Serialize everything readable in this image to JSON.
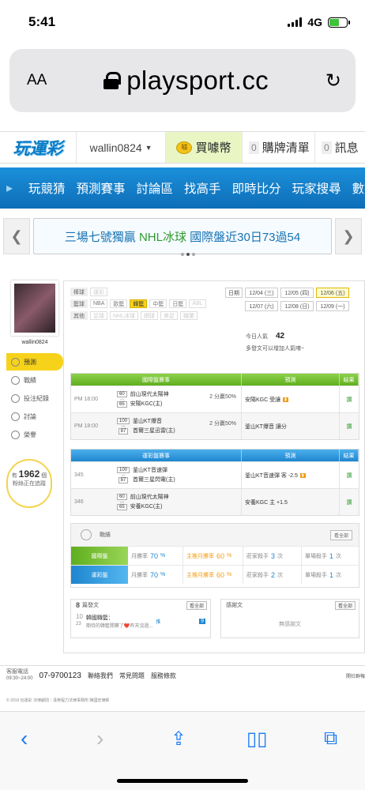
{
  "status": {
    "time": "5:41",
    "network": "4G"
  },
  "browser": {
    "aa": "AA",
    "url": "playsport.cc",
    "reload_icon": "reload-icon"
  },
  "site": {
    "logo": "玩運彩",
    "username": "wallin0824",
    "buy_label": "買噱幣",
    "cart_count": "0",
    "cart_label": "購牌清單",
    "msg_count": "0",
    "msg_label": "訊息"
  },
  "nav": [
    "玩競猜",
    "預測賽事",
    "討論區",
    "找高手",
    "即時比分",
    "玩家搜尋",
    "數據"
  ],
  "banner": {
    "text_blue": "三場七號獨贏",
    "text_green": "NHL冰球",
    "text_tail": "國際盤近30日73過54"
  },
  "sidebar": {
    "username": "wallin0824",
    "menu": [
      "預測",
      "戰績",
      "投注紀錄",
      "討論",
      "榮譽"
    ],
    "viewers_prefix": "有",
    "viewers_count": "1962",
    "viewers_suffix": "個",
    "viewers_text": "粉絲正在追蹤"
  },
  "filters": {
    "rows": [
      {
        "label": "棒球",
        "chips": [
          "運彩"
        ]
      },
      {
        "label": "籃球",
        "chips": [
          "NBA",
          "歐籃",
          "韓籃",
          "中籃",
          "日籃",
          "ABL"
        ]
      },
      {
        "label": "其他",
        "chips": [
          "足球",
          "NHL冰球",
          "網球",
          "美足",
          "職業"
        ]
      }
    ]
  },
  "dates": {
    "label": "日期",
    "row1": [
      "12/04 (三)",
      "12/05 (四)",
      "12/06 (五)"
    ],
    "row2": [
      "12/07 (六)",
      "12/08 (日)",
      "12/09 (一)"
    ]
  },
  "popularity": {
    "label": "今日人氣",
    "value": "42",
    "hint": "多發文可以增加人氣唷~"
  },
  "intl_table": {
    "headers": [
      "國際盤賽事",
      "預測",
      "結果"
    ],
    "rows": [
      {
        "time": "PM 18:00",
        "s1": "60",
        "s2": "65",
        "team1": "前山現代太陽神",
        "team2": "安陽KGC(主)",
        "pct": "2 分贏50%",
        "pred": "安陽KGC 受讓",
        "result": "讚"
      },
      {
        "time": "PM 18:00",
        "s1": "100",
        "s2": "87",
        "team1": "釜山KT爆音",
        "team2": "首爾三星迅雷(主)",
        "pct": "2 分贏50%",
        "pred": "釜山KT爆音 讓分",
        "result": "讚"
      }
    ]
  },
  "lottery_table": {
    "headers": [
      "運彩盤賽事",
      "預測",
      "結果"
    ],
    "rows": [
      {
        "time": "345",
        "s1": "100",
        "s2": "87",
        "team1": "釜山KT音速彈",
        "team2": "首爾三星閃電(主)",
        "pct": "",
        "pred": "釜山KT音速彈 客 -2.5",
        "result": "讚"
      },
      {
        "time": "346",
        "s1": "60",
        "s2": "65",
        "team1": "前山現代太陽神",
        "team2": "安養KGC(主)",
        "pct": "",
        "pred": "安養KGC 主 +1.5",
        "result": "讚"
      }
    ]
  },
  "record": {
    "title": "戰績",
    "see_all": "看全部",
    "rows": [
      {
        "label": "國際盤",
        "month": "月勝率",
        "month_v": "70",
        "main": "主推月勝率",
        "main_v": "60",
        "killer": "莊家殺手",
        "killer_v": "3",
        "single": "單場殺手",
        "single_v": "1"
      },
      {
        "label": "運彩盤",
        "month": "月勝率",
        "month_v": "70",
        "main": "主推月勝率",
        "main_v": "60",
        "killer": "莊家殺手",
        "killer_v": "2",
        "single": "單場殺手",
        "single_v": "1"
      }
    ]
  },
  "posts": {
    "count": "8",
    "label": "篇發文",
    "see_all": "看全部",
    "item": {
      "month": "10",
      "day": "23",
      "title": "韓國職籃：",
      "excerpt": "期待的韓籃開賽了❤️昨天沒過...",
      "badge_prefix": "推",
      "badge": "9"
    }
  },
  "thanks": {
    "label": "感謝文",
    "see_all": "看全部",
    "empty": "無感謝文"
  },
  "footer": {
    "cs_label": "客服電話",
    "cs_hours": "09:30~24:00",
    "phone": "07-9700123",
    "links": [
      "聯絡我們",
      "常見問題",
      "服務條款"
    ],
    "copyright": "© 2019 玩運彩 法律顧問｜漢英程力法律事務所 陳國宏律師",
    "report": "開社群報"
  }
}
